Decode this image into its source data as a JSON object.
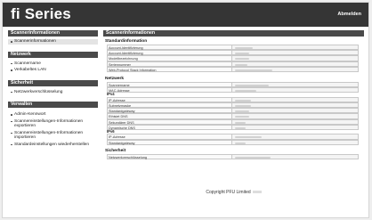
{
  "header": {
    "logo": "fi Series",
    "logout": "Abmelden"
  },
  "sidebar": {
    "sections": [
      {
        "title": "Scannerinformationen",
        "items": [
          "Scannerinformationen"
        ]
      },
      {
        "title": "Netzwerk",
        "items": [
          "Scannername",
          "Verkabeltes LAN"
        ]
      },
      {
        "title": "Sicherheit",
        "items": [
          "Netzwerkverschlüsselung"
        ]
      },
      {
        "title": "Verwalten",
        "items": [
          "Admin-Kennwort",
          "Scannereinstellungen-Informationen exportieren",
          "Scannereinstellungen-Informationen importieren",
          "Standardeinstellungen wiederherstellen"
        ]
      }
    ]
  },
  "main": {
    "title": "Scannerinformationen",
    "groups": {
      "standard": {
        "title": "Standardinformation",
        "rows": [
          "Account-Identifizierung",
          "Account-Identifizierung",
          "Modellbezeichnung",
          "Seriennummer",
          "Web-Protocol Stack Information"
        ]
      },
      "netzwerk": {
        "title": "Netzwerk",
        "rows_top": [
          "Scannername",
          "MAC-Adresse"
        ],
        "ipv4_label": "IPv4",
        "ipv4_rows": [
          "IP-Adresse",
          "Subnetzmaske",
          "Standardgateway",
          "Ethisiet DNS",
          "Sekundärer DNS",
          "Dynamische DNS"
        ],
        "ipv6_label": "IPv6",
        "ipv6_rows": [
          "IP-Adresse",
          "Standardgateway"
        ]
      },
      "sicherheit": {
        "title": "Sicherheit",
        "rows": [
          "Netzwerkverschlüsselung"
        ]
      }
    }
  },
  "footer": {
    "text": "Copyright PFU Limited"
  }
}
